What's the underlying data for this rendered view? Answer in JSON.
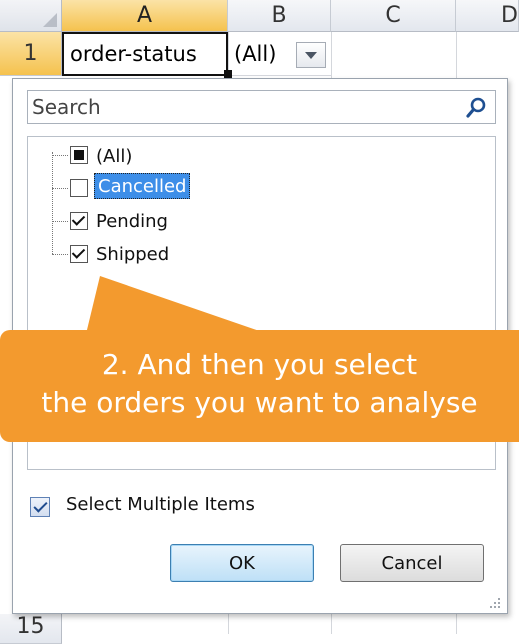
{
  "sheet": {
    "columns": [
      "A",
      "B",
      "C",
      "D"
    ],
    "rows": [
      "1",
      "15"
    ],
    "cells": {
      "a1": "order-status",
      "b1": "(All)"
    }
  },
  "filter_panel": {
    "search_placeholder": "Search",
    "items": [
      {
        "label": "(All)",
        "state": "partial"
      },
      {
        "label": "Cancelled",
        "state": "unchecked",
        "selected": true
      },
      {
        "label": "Pending",
        "state": "checked"
      },
      {
        "label": "Shipped",
        "state": "checked"
      }
    ],
    "select_multiple_label": "Select Multiple Items",
    "select_multiple_checked": true,
    "ok_label": "OK",
    "cancel_label": "Cancel"
  },
  "callout": {
    "line1": "2. And then you select",
    "line2": "the orders you want to analyse",
    "color": "#f39a2e"
  },
  "icons": [
    "search-icon",
    "chevron-down-icon",
    "resize-grip-icon"
  ]
}
